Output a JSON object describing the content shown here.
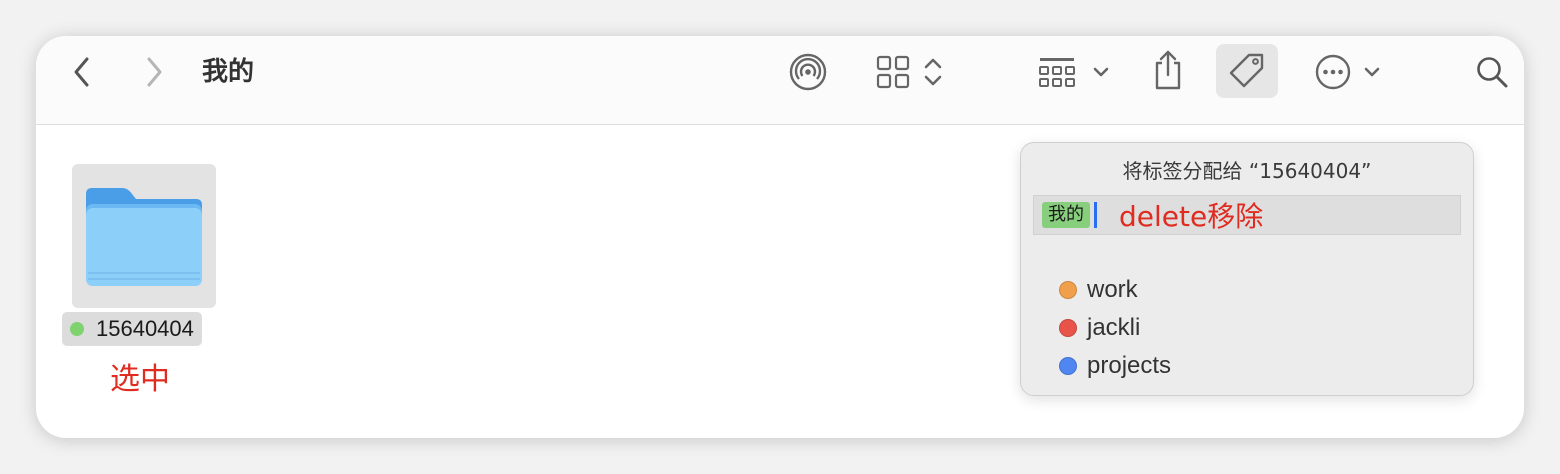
{
  "window": {
    "title": "我的"
  },
  "toolbar": {
    "back_icon": "chevron-left-icon",
    "forward_icon": "chevron-right-icon",
    "airdrop_icon": "airdrop-icon",
    "view_icon": "grid-view-icon",
    "group_icon": "group-by-icon",
    "share_icon": "share-icon",
    "tag_icon": "tag-icon",
    "more_icon": "ellipsis-circle-icon",
    "search_icon": "search-icon"
  },
  "content": {
    "file": {
      "name": "15640404",
      "tag_color": "#7ed36f"
    },
    "annotation": "选中"
  },
  "popover": {
    "title": "将标签分配给 “15640404”",
    "input": {
      "token": "我的",
      "token_color": "#88cf7d",
      "annotation": "delete移除"
    },
    "tags": [
      {
        "label": "work",
        "color": "#f0a04b"
      },
      {
        "label": "jackli",
        "color": "#e8544a"
      },
      {
        "label": "projects",
        "color": "#4f86f1"
      }
    ]
  },
  "colors": {
    "annotation_red": "#e02c20",
    "caret_blue": "#2a6df0"
  }
}
